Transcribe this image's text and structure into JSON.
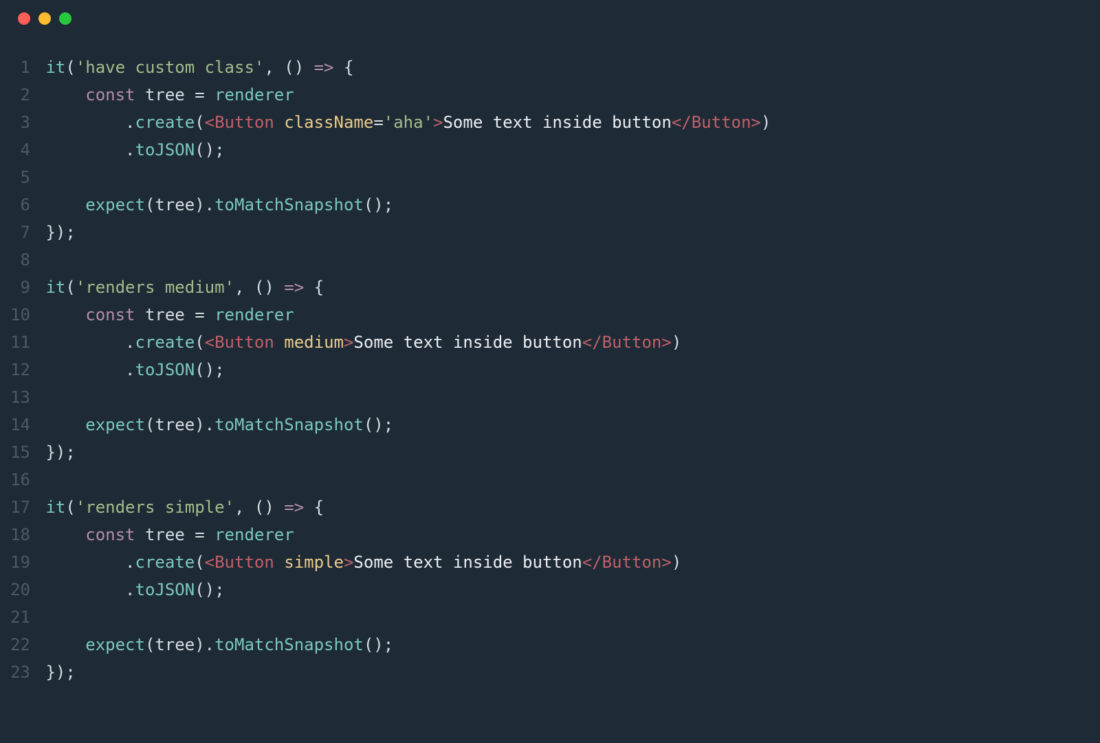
{
  "window": {
    "traffic_colors": [
      "#ff5f56",
      "#ffbd2e",
      "#27c93f"
    ]
  },
  "editor": {
    "line_count": 23,
    "lines": [
      [
        {
          "cls": "t-fn",
          "t": "it"
        },
        {
          "cls": "t-punc",
          "t": "("
        },
        {
          "cls": "t-str",
          "t": "'have custom class'"
        },
        {
          "cls": "t-punc",
          "t": ", () "
        },
        {
          "cls": "t-kw",
          "t": "=>"
        },
        {
          "cls": "t-punc",
          "t": " {"
        }
      ],
      [
        {
          "cls": "t-punc",
          "t": "    "
        },
        {
          "cls": "t-kw",
          "t": "const"
        },
        {
          "cls": "t-punc",
          "t": " "
        },
        {
          "cls": "t-ident",
          "t": "tree"
        },
        {
          "cls": "t-punc",
          "t": " = "
        },
        {
          "cls": "t-fn",
          "t": "renderer"
        }
      ],
      [
        {
          "cls": "t-punc",
          "t": "        ."
        },
        {
          "cls": "t-fn",
          "t": "create"
        },
        {
          "cls": "t-punc",
          "t": "("
        },
        {
          "cls": "t-tagbr",
          "t": "<"
        },
        {
          "cls": "t-tag",
          "t": "Button"
        },
        {
          "cls": "t-punc",
          "t": " "
        },
        {
          "cls": "t-attr",
          "t": "className"
        },
        {
          "cls": "t-eq",
          "t": "="
        },
        {
          "cls": "t-str",
          "t": "'aha'"
        },
        {
          "cls": "t-tagbr",
          "t": ">"
        },
        {
          "cls": "t-txt",
          "t": "Some text inside button"
        },
        {
          "cls": "t-tagbr",
          "t": "</"
        },
        {
          "cls": "t-tag",
          "t": "Button"
        },
        {
          "cls": "t-tagbr",
          "t": ">"
        },
        {
          "cls": "t-punc",
          "t": ")"
        }
      ],
      [
        {
          "cls": "t-punc",
          "t": "        ."
        },
        {
          "cls": "t-fn",
          "t": "toJSON"
        },
        {
          "cls": "t-punc",
          "t": "();"
        }
      ],
      [],
      [
        {
          "cls": "t-punc",
          "t": "    "
        },
        {
          "cls": "t-fn",
          "t": "expect"
        },
        {
          "cls": "t-punc",
          "t": "("
        },
        {
          "cls": "t-ident",
          "t": "tree"
        },
        {
          "cls": "t-punc",
          "t": ")."
        },
        {
          "cls": "t-fn",
          "t": "toMatchSnapshot"
        },
        {
          "cls": "t-punc",
          "t": "();"
        }
      ],
      [
        {
          "cls": "t-punc",
          "t": "});"
        }
      ],
      [],
      [
        {
          "cls": "t-fn",
          "t": "it"
        },
        {
          "cls": "t-punc",
          "t": "("
        },
        {
          "cls": "t-str",
          "t": "'renders medium'"
        },
        {
          "cls": "t-punc",
          "t": ", () "
        },
        {
          "cls": "t-kw",
          "t": "=>"
        },
        {
          "cls": "t-punc",
          "t": " {"
        }
      ],
      [
        {
          "cls": "t-punc",
          "t": "    "
        },
        {
          "cls": "t-kw",
          "t": "const"
        },
        {
          "cls": "t-punc",
          "t": " "
        },
        {
          "cls": "t-ident",
          "t": "tree"
        },
        {
          "cls": "t-punc",
          "t": " = "
        },
        {
          "cls": "t-fn",
          "t": "renderer"
        }
      ],
      [
        {
          "cls": "t-punc",
          "t": "        ."
        },
        {
          "cls": "t-fn",
          "t": "create"
        },
        {
          "cls": "t-punc",
          "t": "("
        },
        {
          "cls": "t-tagbr",
          "t": "<"
        },
        {
          "cls": "t-tag",
          "t": "Button"
        },
        {
          "cls": "t-punc",
          "t": " "
        },
        {
          "cls": "t-attr",
          "t": "medium"
        },
        {
          "cls": "t-tagbr",
          "t": ">"
        },
        {
          "cls": "t-txt",
          "t": "Some text inside button"
        },
        {
          "cls": "t-tagbr",
          "t": "</"
        },
        {
          "cls": "t-tag",
          "t": "Button"
        },
        {
          "cls": "t-tagbr",
          "t": ">"
        },
        {
          "cls": "t-punc",
          "t": ")"
        }
      ],
      [
        {
          "cls": "t-punc",
          "t": "        ."
        },
        {
          "cls": "t-fn",
          "t": "toJSON"
        },
        {
          "cls": "t-punc",
          "t": "();"
        }
      ],
      [],
      [
        {
          "cls": "t-punc",
          "t": "    "
        },
        {
          "cls": "t-fn",
          "t": "expect"
        },
        {
          "cls": "t-punc",
          "t": "("
        },
        {
          "cls": "t-ident",
          "t": "tree"
        },
        {
          "cls": "t-punc",
          "t": ")."
        },
        {
          "cls": "t-fn",
          "t": "toMatchSnapshot"
        },
        {
          "cls": "t-punc",
          "t": "();"
        }
      ],
      [
        {
          "cls": "t-punc",
          "t": "});"
        }
      ],
      [],
      [
        {
          "cls": "t-fn",
          "t": "it"
        },
        {
          "cls": "t-punc",
          "t": "("
        },
        {
          "cls": "t-str",
          "t": "'renders simple'"
        },
        {
          "cls": "t-punc",
          "t": ", () "
        },
        {
          "cls": "t-kw",
          "t": "=>"
        },
        {
          "cls": "t-punc",
          "t": " {"
        }
      ],
      [
        {
          "cls": "t-punc",
          "t": "    "
        },
        {
          "cls": "t-kw",
          "t": "const"
        },
        {
          "cls": "t-punc",
          "t": " "
        },
        {
          "cls": "t-ident",
          "t": "tree"
        },
        {
          "cls": "t-punc",
          "t": " = "
        },
        {
          "cls": "t-fn",
          "t": "renderer"
        }
      ],
      [
        {
          "cls": "t-punc",
          "t": "        ."
        },
        {
          "cls": "t-fn",
          "t": "create"
        },
        {
          "cls": "t-punc",
          "t": "("
        },
        {
          "cls": "t-tagbr",
          "t": "<"
        },
        {
          "cls": "t-tag",
          "t": "Button"
        },
        {
          "cls": "t-punc",
          "t": " "
        },
        {
          "cls": "t-attr",
          "t": "simple"
        },
        {
          "cls": "t-tagbr",
          "t": ">"
        },
        {
          "cls": "t-txt",
          "t": "Some text inside button"
        },
        {
          "cls": "t-tagbr",
          "t": "</"
        },
        {
          "cls": "t-tag",
          "t": "Button"
        },
        {
          "cls": "t-tagbr",
          "t": ">"
        },
        {
          "cls": "t-punc",
          "t": ")"
        }
      ],
      [
        {
          "cls": "t-punc",
          "t": "        ."
        },
        {
          "cls": "t-fn",
          "t": "toJSON"
        },
        {
          "cls": "t-punc",
          "t": "();"
        }
      ],
      [],
      [
        {
          "cls": "t-punc",
          "t": "    "
        },
        {
          "cls": "t-fn",
          "t": "expect"
        },
        {
          "cls": "t-punc",
          "t": "("
        },
        {
          "cls": "t-ident",
          "t": "tree"
        },
        {
          "cls": "t-punc",
          "t": ")."
        },
        {
          "cls": "t-fn",
          "t": "toMatchSnapshot"
        },
        {
          "cls": "t-punc",
          "t": "();"
        }
      ],
      [
        {
          "cls": "t-punc",
          "t": "});"
        }
      ]
    ]
  }
}
